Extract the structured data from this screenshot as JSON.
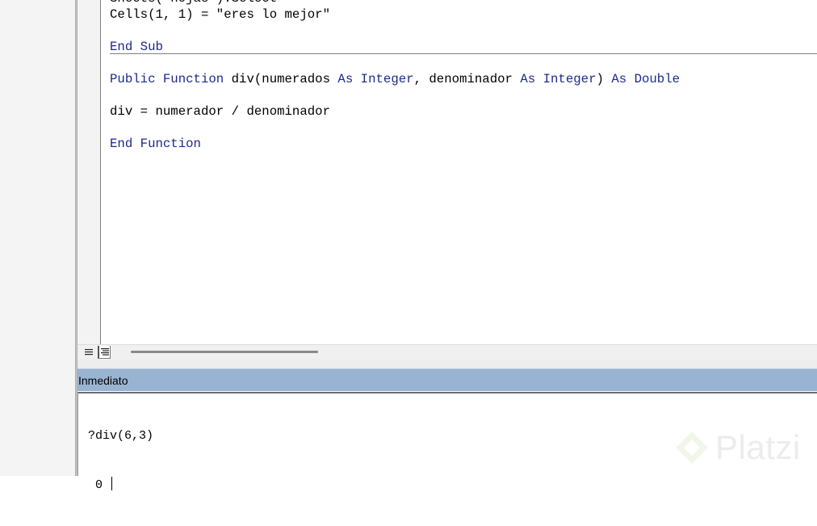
{
  "code_window": {
    "lines": [
      {
        "segments": [
          {
            "t": "Sheets(\"hojas\").Select",
            "kw": false
          }
        ]
      },
      {
        "segments": [
          {
            "t": "Cells(1, 1) = \"eres lo mejor\"",
            "kw": false
          }
        ]
      },
      {
        "segments": [
          {
            "t": "",
            "kw": false
          }
        ]
      },
      {
        "segments": [
          {
            "t": "End Sub",
            "kw": true
          }
        ]
      },
      {
        "segments": [
          {
            "t": "",
            "kw": false
          }
        ]
      },
      {
        "segments": [
          {
            "t": "Public Function ",
            "kw": true
          },
          {
            "t": "div(numerados ",
            "kw": false
          },
          {
            "t": "As Integer",
            "kw": true
          },
          {
            "t": ", denominador ",
            "kw": false
          },
          {
            "t": "As Integer",
            "kw": true
          },
          {
            "t": ") ",
            "kw": false
          },
          {
            "t": "As Double",
            "kw": true
          }
        ]
      },
      {
        "segments": [
          {
            "t": "",
            "kw": false
          }
        ]
      },
      {
        "segments": [
          {
            "t": "div = numerador / denominador",
            "kw": false
          }
        ]
      },
      {
        "segments": [
          {
            "t": "",
            "kw": false
          }
        ]
      },
      {
        "segments": [
          {
            "t": "End Function",
            "kw": true
          }
        ]
      }
    ],
    "procedure_view_icon": "procedure-view-icon",
    "full_module_view_icon": "full-module-view-icon"
  },
  "immediate": {
    "title": "Inmediato",
    "lines": [
      "?div(6,3)",
      " 0 "
    ]
  },
  "watermark": {
    "text": "Platzi",
    "icon": "platzi-logo-icon"
  },
  "colors": {
    "keyword": "#1c2a8d",
    "title_bar": "#99b3d2"
  }
}
